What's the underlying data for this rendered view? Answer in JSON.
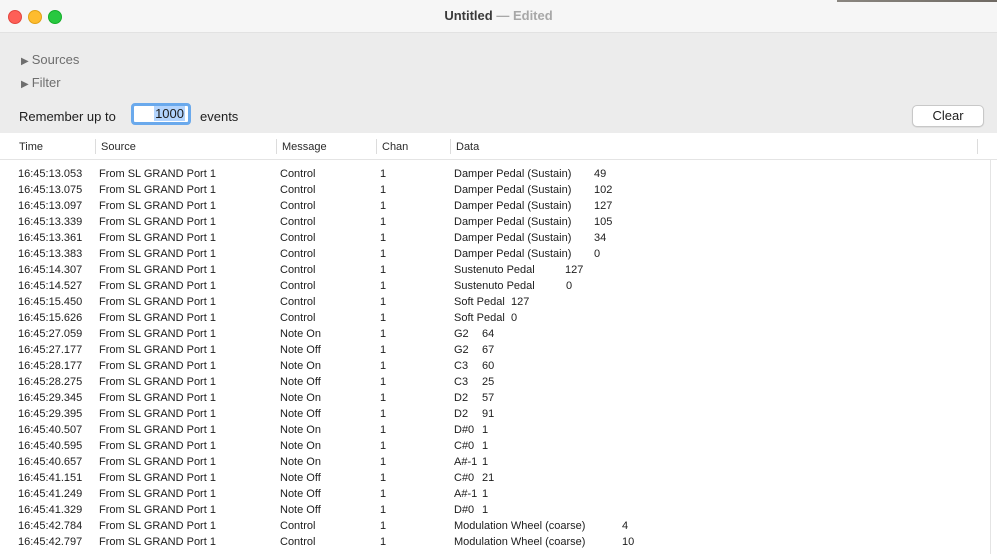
{
  "window": {
    "title": "Untitled",
    "title_separator": "—",
    "title_status": "Edited"
  },
  "controls": {
    "sources_label": "Sources",
    "filter_label": "Filter",
    "remember_prefix": "Remember up to",
    "remember_value": "1000",
    "remember_suffix": "events",
    "clear_label": "Clear"
  },
  "table": {
    "columns": [
      "Time",
      "Source",
      "Message",
      "Chan",
      "Data"
    ],
    "rows": [
      {
        "time": "16:45:13.053",
        "source": "From SL GRAND Port 1",
        "message": "Control",
        "chan": "1",
        "data1": "Damper Pedal (Sustain)",
        "data2": "49",
        "d2x": 594
      },
      {
        "time": "16:45:13.075",
        "source": "From SL GRAND Port 1",
        "message": "Control",
        "chan": "1",
        "data1": "Damper Pedal (Sustain)",
        "data2": "102",
        "d2x": 594
      },
      {
        "time": "16:45:13.097",
        "source": "From SL GRAND Port 1",
        "message": "Control",
        "chan": "1",
        "data1": "Damper Pedal (Sustain)",
        "data2": "127",
        "d2x": 594
      },
      {
        "time": "16:45:13.339",
        "source": "From SL GRAND Port 1",
        "message": "Control",
        "chan": "1",
        "data1": "Damper Pedal (Sustain)",
        "data2": "105",
        "d2x": 594
      },
      {
        "time": "16:45:13.361",
        "source": "From SL GRAND Port 1",
        "message": "Control",
        "chan": "1",
        "data1": "Damper Pedal (Sustain)",
        "data2": "34",
        "d2x": 594
      },
      {
        "time": "16:45:13.383",
        "source": "From SL GRAND Port 1",
        "message": "Control",
        "chan": "1",
        "data1": "Damper Pedal (Sustain)",
        "data2": "0",
        "d2x": 594
      },
      {
        "time": "16:45:14.307",
        "source": "From SL GRAND Port 1",
        "message": "Control",
        "chan": "1",
        "data1": "Sustenuto Pedal",
        "data2": "127",
        "d2x": 565
      },
      {
        "time": "16:45:14.527",
        "source": "From SL GRAND Port 1",
        "message": "Control",
        "chan": "1",
        "data1": "Sustenuto Pedal",
        "data2": "0",
        "d2x": 566
      },
      {
        "time": "16:45:15.450",
        "source": "From SL GRAND Port 1",
        "message": "Control",
        "chan": "1",
        "data1": "Soft Pedal",
        "data2": "127",
        "d2x": 511
      },
      {
        "time": "16:45:15.626",
        "source": "From SL GRAND Port 1",
        "message": "Control",
        "chan": "1",
        "data1": "Soft Pedal",
        "data2": "0",
        "d2x": 511
      },
      {
        "time": "16:45:27.059",
        "source": "From SL GRAND Port 1",
        "message": "Note On",
        "chan": "1",
        "data1": "G2",
        "data2": "64",
        "d2x": 482
      },
      {
        "time": "16:45:27.177",
        "source": "From SL GRAND Port 1",
        "message": "Note Off",
        "chan": "1",
        "data1": "G2",
        "data2": "67",
        "d2x": 482
      },
      {
        "time": "16:45:28.177",
        "source": "From SL GRAND Port 1",
        "message": "Note On",
        "chan": "1",
        "data1": "C3",
        "data2": "60",
        "d2x": 482
      },
      {
        "time": "16:45:28.275",
        "source": "From SL GRAND Port 1",
        "message": "Note Off",
        "chan": "1",
        "data1": "C3",
        "data2": "25",
        "d2x": 482
      },
      {
        "time": "16:45:29.345",
        "source": "From SL GRAND Port 1",
        "message": "Note On",
        "chan": "1",
        "data1": "D2",
        "data2": "57",
        "d2x": 482
      },
      {
        "time": "16:45:29.395",
        "source": "From SL GRAND Port 1",
        "message": "Note Off",
        "chan": "1",
        "data1": "D2",
        "data2": "91",
        "d2x": 482
      },
      {
        "time": "16:45:40.507",
        "source": "From SL GRAND Port 1",
        "message": "Note On",
        "chan": "1",
        "data1": "D#0",
        "data2": "1",
        "d2x": 482
      },
      {
        "time": "16:45:40.595",
        "source": "From SL GRAND Port 1",
        "message": "Note On",
        "chan": "1",
        "data1": "C#0",
        "data2": "1",
        "d2x": 482
      },
      {
        "time": "16:45:40.657",
        "source": "From SL GRAND Port 1",
        "message": "Note On",
        "chan": "1",
        "data1": "A#-1",
        "data2": "1",
        "d2x": 482
      },
      {
        "time": "16:45:41.151",
        "source": "From SL GRAND Port 1",
        "message": "Note Off",
        "chan": "1",
        "data1": "C#0",
        "data2": "21",
        "d2x": 482
      },
      {
        "time": "16:45:41.249",
        "source": "From SL GRAND Port 1",
        "message": "Note Off",
        "chan": "1",
        "data1": "A#-1",
        "data2": "1",
        "d2x": 482
      },
      {
        "time": "16:45:41.329",
        "source": "From SL GRAND Port 1",
        "message": "Note Off",
        "chan": "1",
        "data1": "D#0",
        "data2": "1",
        "d2x": 482
      },
      {
        "time": "16:45:42.784",
        "source": "From SL GRAND Port 1",
        "message": "Control",
        "chan": "1",
        "data1": "Modulation Wheel (coarse)",
        "data2": "4",
        "d2x": 622
      },
      {
        "time": "16:45:42.797",
        "source": "From SL GRAND Port 1",
        "message": "Control",
        "chan": "1",
        "data1": "Modulation Wheel (coarse)",
        "data2": "10",
        "d2x": 622
      }
    ]
  }
}
